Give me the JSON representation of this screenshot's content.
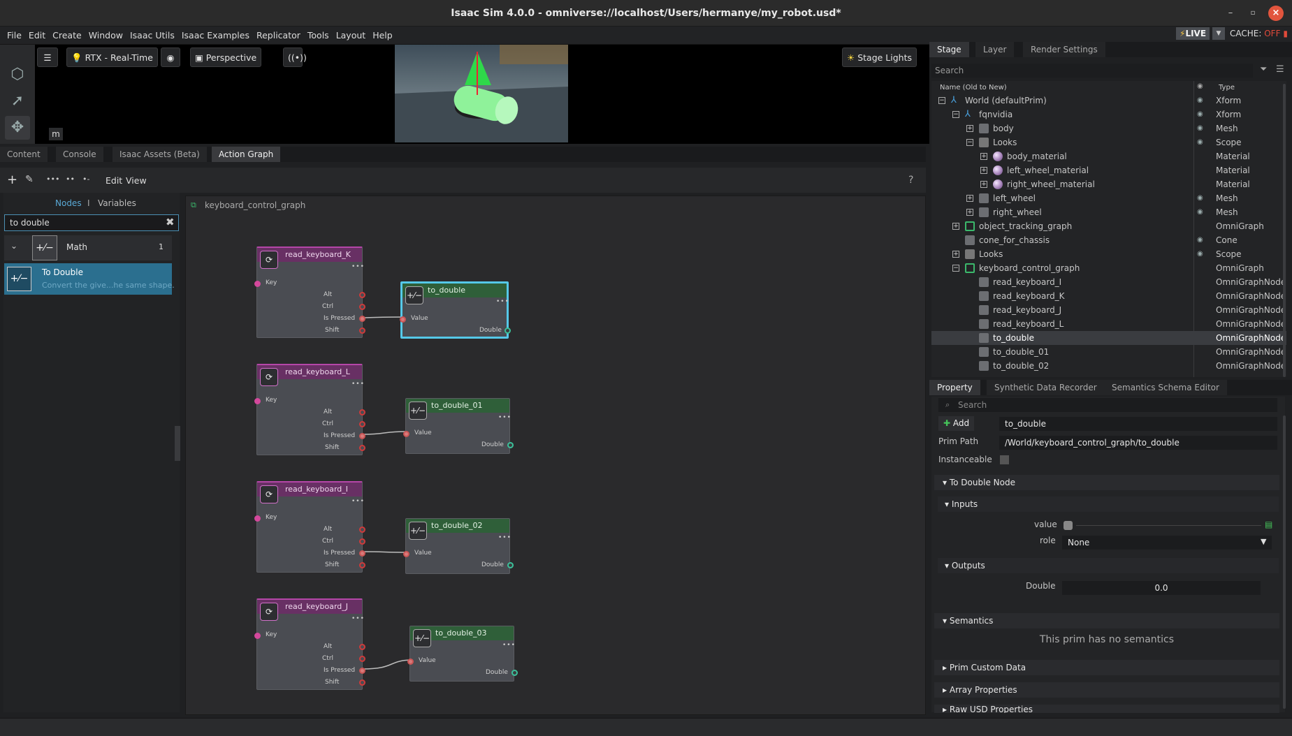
{
  "window": {
    "title": "Isaac Sim 4.0.0 - omniverse://localhost/Users/hermanye/my_robot.usd*",
    "min_icon": "minimize-icon",
    "max_icon": "maximize-icon",
    "close_icon": "close-icon"
  },
  "menu": [
    "File",
    "Edit",
    "Create",
    "Window",
    "Isaac Utils",
    "Isaac Examples",
    "Replicator",
    "Tools",
    "Layout",
    "Help"
  ],
  "status": {
    "live": "LIVE",
    "cache_label": "CACHE:",
    "cache_state": "OFF"
  },
  "viewport": {
    "renderer": "RTX - Real-Time",
    "camera": "Perspective",
    "lights": "Stage Lights",
    "m_label": "m"
  },
  "bottom_tabs": [
    "Content",
    "Console",
    "Isaac Assets (Beta)",
    "Action Graph"
  ],
  "graph_toolbar": {
    "edit": "Edit",
    "view": "View",
    "help": "?"
  },
  "node_library": {
    "tab_nodes": "Nodes",
    "separator": "I",
    "tab_variables": "Variables",
    "search_value": "to double",
    "category": "Math",
    "category_count": "1",
    "item_title": "To Double",
    "item_desc": "Convert the give...he same shape."
  },
  "graph": {
    "breadcrumb": "keyboard_control_graph",
    "kb_pins": {
      "key": "Key",
      "alt": "Alt",
      "ctrl": "Ctrl",
      "pressed": "Is Pressed",
      "shift": "Shift"
    },
    "td_pins": {
      "value": "Value",
      "double": "Double"
    },
    "keyboard_nodes": [
      "read_keyboard_K",
      "read_keyboard_L",
      "read_keyboard_I",
      "read_keyboard_J"
    ],
    "double_nodes": [
      "to_double",
      "to_double_01",
      "to_double_02",
      "to_double_03"
    ],
    "dots": "•••"
  },
  "right_tabs": [
    "Stage",
    "Layer",
    "Render Settings"
  ],
  "stage": {
    "search_placeholder": "Search",
    "col_name": "Name (Old to New)",
    "col_type": "Type",
    "rows": [
      {
        "name": "World (defaultPrim)",
        "type": "Xform"
      },
      {
        "name": "fqnvidia",
        "type": "Xform"
      },
      {
        "name": "body",
        "type": "Mesh"
      },
      {
        "name": "Looks",
        "type": "Scope"
      },
      {
        "name": "body_material",
        "type": "Material"
      },
      {
        "name": "left_wheel_material",
        "type": "Material"
      },
      {
        "name": "right_wheel_material",
        "type": "Material"
      },
      {
        "name": "left_wheel",
        "type": "Mesh"
      },
      {
        "name": "right_wheel",
        "type": "Mesh"
      },
      {
        "name": "object_tracking_graph",
        "type": "OmniGraph"
      },
      {
        "name": "cone_for_chassis",
        "type": "Cone"
      },
      {
        "name": "Looks",
        "type": "Scope"
      },
      {
        "name": "keyboard_control_graph",
        "type": "OmniGraph"
      },
      {
        "name": "read_keyboard_I",
        "type": "OmniGraphNode"
      },
      {
        "name": "read_keyboard_K",
        "type": "OmniGraphNode"
      },
      {
        "name": "read_keyboard_J",
        "type": "OmniGraphNode"
      },
      {
        "name": "read_keyboard_L",
        "type": "OmniGraphNode"
      },
      {
        "name": "to_double",
        "type": "OmniGraphNode"
      },
      {
        "name": "to_double_01",
        "type": "OmniGraphNode"
      },
      {
        "name": "to_double_02",
        "type": "OmniGraphNode"
      }
    ]
  },
  "prop_tabs": [
    "Property",
    "Synthetic Data Recorder",
    "Semantics Schema Editor"
  ],
  "property": {
    "search_placeholder": "Search",
    "add": "Add",
    "name_value": "to_double",
    "prim_path_label": "Prim Path",
    "prim_path": "/World/keyboard_control_graph/to_double",
    "instanceable": "Instanceable",
    "section_node": "To Double Node",
    "section_inputs": "Inputs",
    "value_label": "value",
    "role_label": "role",
    "role_value": "None",
    "section_outputs": "Outputs",
    "double_label": "Double",
    "double_value": "0.0",
    "section_semantics": "Semantics",
    "no_semantics": "This prim has no semantics",
    "section_custom": "Prim Custom Data",
    "section_array": "Array Properties",
    "section_raw": "Raw USD Properties"
  }
}
